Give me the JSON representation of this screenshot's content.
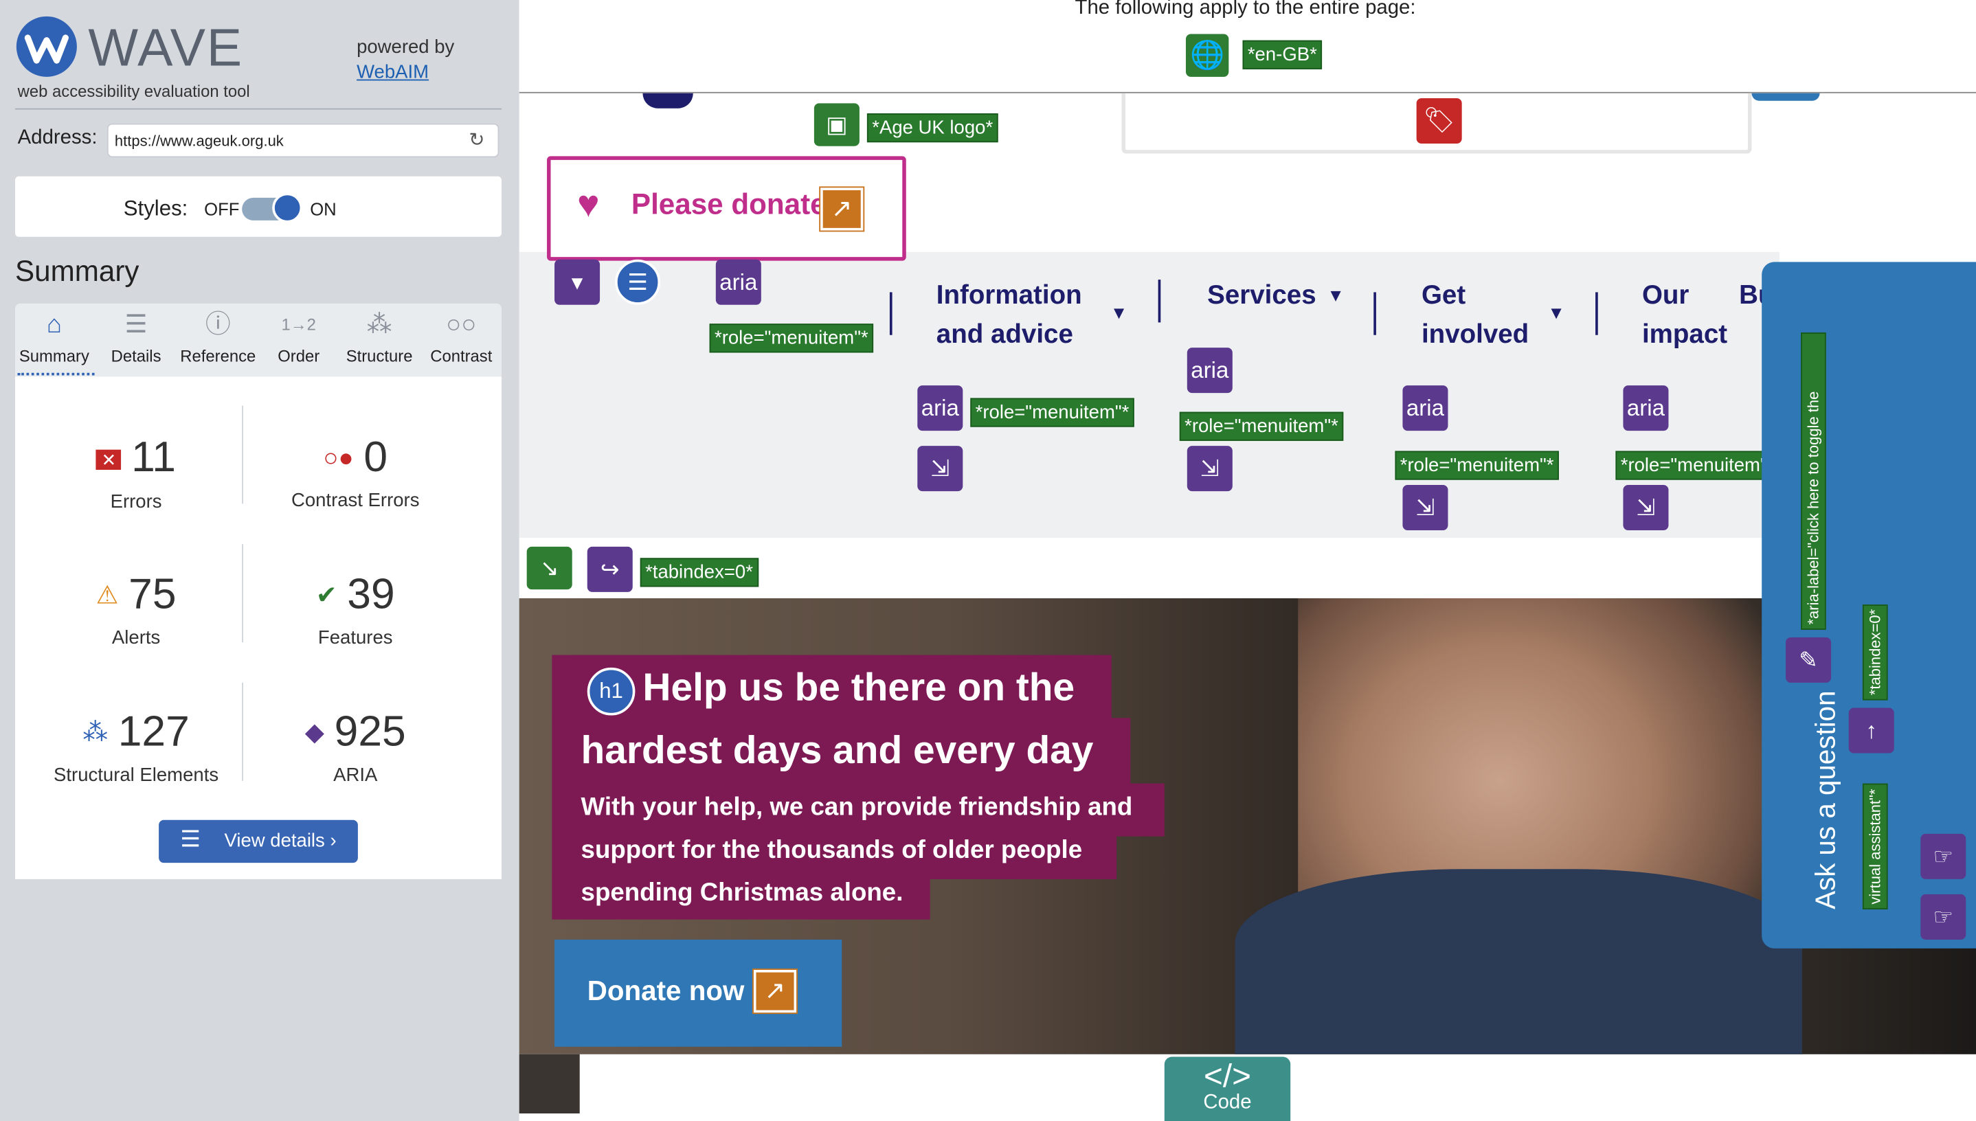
{
  "wave": {
    "title": "WAVE",
    "subtitle": "web accessibility evaluation tool",
    "powered_by": "powered by",
    "webaim": "WebAIM"
  },
  "address": {
    "label": "Address:",
    "value": "https://www.ageuk.org.uk"
  },
  "styles": {
    "label": "Styles:",
    "off": "OFF",
    "on": "ON"
  },
  "summary": {
    "heading": "Summary"
  },
  "tabs": [
    {
      "label": "Summary",
      "icon": "home-icon"
    },
    {
      "label": "Details",
      "icon": "list-icon"
    },
    {
      "label": "Reference",
      "icon": "info-icon"
    },
    {
      "label": "Order",
      "icon": "order-icon"
    },
    {
      "label": "Structure",
      "icon": "structure-icon"
    },
    {
      "label": "Contrast",
      "icon": "contrast-icon"
    }
  ],
  "stats": {
    "errors": {
      "num": "11",
      "label": "Errors"
    },
    "contrast": {
      "num": "0",
      "label": "Contrast Errors"
    },
    "alerts": {
      "num": "75",
      "label": "Alerts"
    },
    "features": {
      "num": "39",
      "label": "Features"
    },
    "structural": {
      "num": "127",
      "label": "Structural Elements"
    },
    "aria": {
      "num": "925",
      "label": "ARIA"
    }
  },
  "view_details": "View details ›",
  "page": {
    "applies": "The following apply to the entire page:",
    "lang": "*en-GB*",
    "logo_alt": "*Age UK logo*",
    "please_donate": "Please donate",
    "aria": "aria",
    "role_menuitem": "*role=\"menuitem\"*",
    "role_menuitem_cut": "*role=\"menuitem\"",
    "tabindex": "*tabindex=0*",
    "nav": [
      "Information",
      "and advice",
      "Services",
      "Get",
      "involved",
      "Our",
      "impact",
      "Bu"
    ],
    "hero_h1_a": "Help us be there on the",
    "hero_h1_b": "hardest days and every day",
    "h1": "h1",
    "hero_p": [
      "With your help, we can provide friendship and",
      "support for the thousands of older people",
      "spending Christmas alone."
    ],
    "donate_now": "Donate now",
    "ask": "Ask us a question",
    "aria_label_note": "*aria-label=\"click here to toggle the",
    "tabindex_side": "*tabindex=0*",
    "virtual_assistant": "virtual assistant\"*",
    "code": "Code",
    "code_icon": "</>"
  },
  "colors": {
    "accent": "#2f62b5",
    "error": "#c62828",
    "feature": "#2e7d32",
    "aria": "#5b3a8e",
    "brand_pink": "#c02e8c",
    "hero_band": "#7d1a53"
  }
}
